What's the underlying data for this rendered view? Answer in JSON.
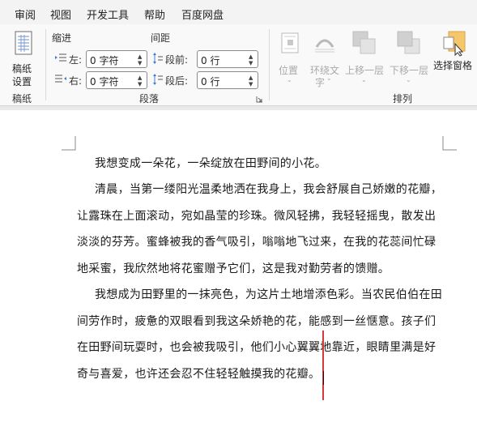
{
  "menu": [
    "审阅",
    "视图",
    "开发工具",
    "帮助",
    "百度网盘"
  ],
  "ribbon": {
    "manuscript": {
      "button_label_line1": "稿纸",
      "button_label_line2": "设置",
      "group_label": "稿纸"
    },
    "paragraph": {
      "indent_heading": "缩进",
      "spacing_heading": "间距",
      "indent_left_label": "左:",
      "indent_left_value": "0 字符",
      "indent_right_label": "右:",
      "indent_right_value": "0 字符",
      "space_before_label": "段前:",
      "space_before_value": "0 行",
      "space_after_label": "段后:",
      "space_after_value": "0 行",
      "group_label": "段落"
    },
    "arrange": {
      "position_label": "位置",
      "wrap_label_line1": "环绕文",
      "wrap_label_line2": "字",
      "bring_forward_label": "上移一层",
      "send_backward_label": "下移一层",
      "selection_pane_label": "选择窗格",
      "group_label": "排列"
    }
  },
  "document": {
    "paragraphs": [
      "我想变成一朵花，一朵绽放在田野间的小花。",
      "清晨，当第一缕阳光温柔地洒在我身上，我会舒展自己娇嫩的花瓣，让露珠在上面滚动，宛如晶莹的珍珠。微风轻拂，我轻轻摇曳，散发出淡淡的芬芳。蜜蜂被我的香气吸引，嗡嗡地飞过来，在我的花蕊间忙碌地采蜜，我欣然地将花蜜赠予它们，这是我对勤劳者的馈赠。",
      "我想成为田野里的一抹亮色，为这片土地增添色彩。当农民伯伯在田间劳作时，疲惫的双眼看到我这朵娇艳的花，能感到一丝惬意。孩子们在田野间玩耍时，也会被我吸引，他们小心翼翼地靠近，眼睛里满是好奇与喜爱，也许还会忍不住轻轻触摸我的花瓣。"
    ]
  },
  "colors": {
    "accent": "#d43a3a",
    "selection_pane_icon": "#f5c76a"
  }
}
